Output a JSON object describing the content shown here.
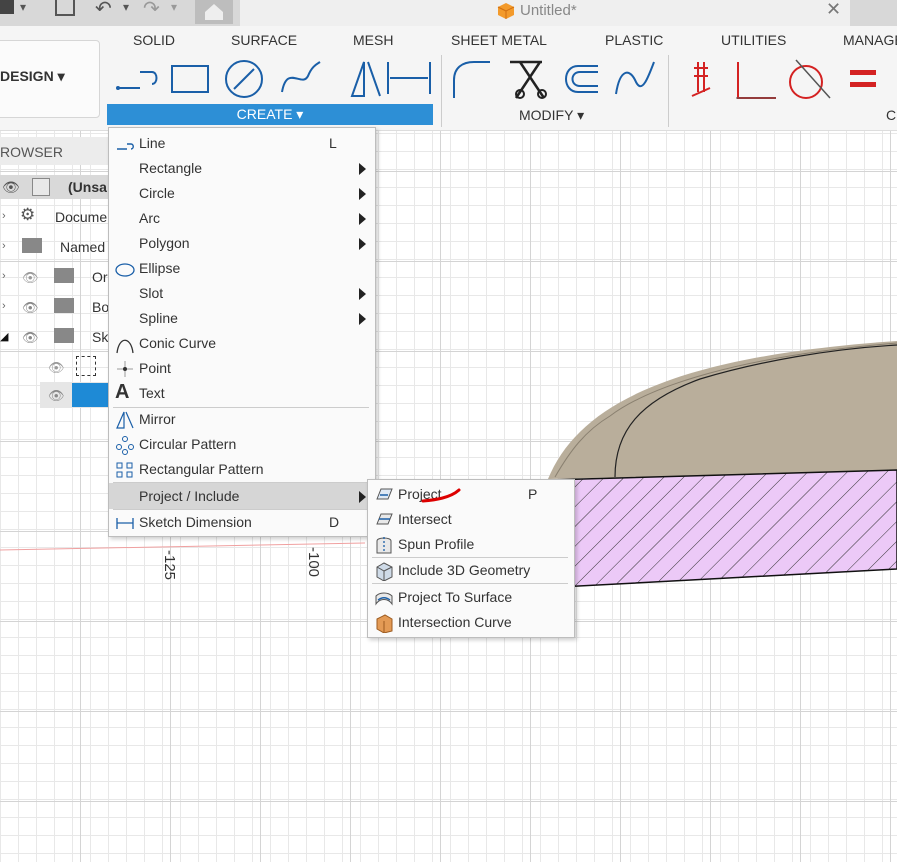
{
  "window": {
    "title": "Untitled*"
  },
  "ribbon": {
    "workspace": "DESIGN",
    "tabs": [
      "SOLID",
      "SURFACE",
      "MESH",
      "SHEET METAL",
      "PLASTIC",
      "UTILITIES",
      "MANAGE"
    ],
    "groups": {
      "create": "CREATE",
      "modify": "MODIFY",
      "constraints": "C"
    }
  },
  "browser": {
    "title": "ROWSER",
    "items": [
      {
        "label": "(Unsa",
        "icon": "component-icon"
      },
      {
        "label": "Docume",
        "icon": "gear-icon"
      },
      {
        "label": "Named",
        "icon": "folder-icon"
      },
      {
        "label": "Or",
        "icon": "folder-icon"
      },
      {
        "label": "Bo",
        "icon": "folder-icon"
      },
      {
        "label": "Sk",
        "icon": "folder-icon"
      }
    ]
  },
  "create_menu": {
    "items": [
      {
        "label": "Line",
        "shortcut": "L",
        "icon": "line-icon"
      },
      {
        "label": "Rectangle",
        "submenu": true
      },
      {
        "label": "Circle",
        "submenu": true
      },
      {
        "label": "Arc",
        "submenu": true
      },
      {
        "label": "Polygon",
        "submenu": true
      },
      {
        "label": "Ellipse",
        "icon": "ellipse-icon"
      },
      {
        "label": "Slot",
        "submenu": true
      },
      {
        "label": "Spline",
        "submenu": true
      },
      {
        "label": "Conic Curve",
        "icon": "conic-curve-icon"
      },
      {
        "label": "Point",
        "icon": "point-icon"
      },
      {
        "label": "Text",
        "icon": "text-icon"
      },
      {
        "label": "Mirror",
        "icon": "mirror-icon"
      },
      {
        "label": "Circular Pattern",
        "icon": "circular-pattern-icon"
      },
      {
        "label": "Rectangular Pattern",
        "icon": "rectangular-pattern-icon"
      },
      {
        "label": "Project / Include",
        "submenu": true,
        "highlighted": true
      },
      {
        "label": "Sketch Dimension",
        "shortcut": "D",
        "icon": "sketch-dimension-icon"
      }
    ]
  },
  "project_submenu": {
    "items": [
      {
        "label": "Project",
        "shortcut": "P",
        "icon": "project-icon"
      },
      {
        "label": "Intersect",
        "icon": "intersect-icon"
      },
      {
        "label": "Spun Profile",
        "icon": "spun-profile-icon"
      },
      {
        "label": "Include 3D Geometry",
        "icon": "include-3d-geometry-icon"
      },
      {
        "label": "Project To Surface",
        "icon": "project-to-surface-icon"
      },
      {
        "label": "Intersection Curve",
        "icon": "intersection-curve-icon"
      }
    ]
  },
  "canvas": {
    "axis_labels": [
      "-125",
      "-100"
    ]
  },
  "colors": {
    "accent": "#2d8fd6",
    "section_hatch_fill": "#ecc9f7",
    "body": "#b7ab97",
    "annotation": "#dd0000"
  }
}
